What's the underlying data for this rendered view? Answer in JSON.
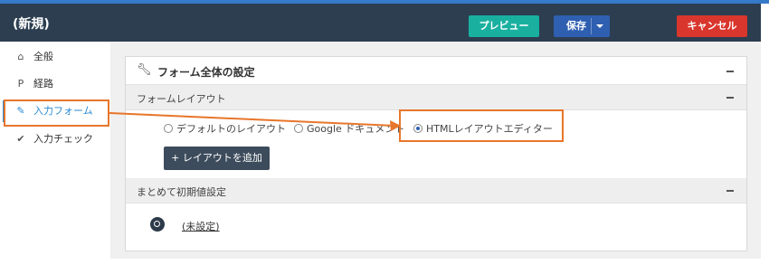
{
  "header": {
    "title": "(新規)",
    "preview_label": "プレビュー",
    "save_label": "保存",
    "cancel_label": "キャンセル"
  },
  "sidebar": {
    "items": [
      {
        "label": "全般",
        "icon": "home-icon"
      },
      {
        "label": "経路",
        "icon": "route-icon"
      },
      {
        "label": "入力フォーム",
        "icon": "pencil-icon",
        "active": true
      },
      {
        "label": "入力チェック",
        "icon": "check-icon"
      }
    ]
  },
  "panel": {
    "title": "フォーム全体の設定",
    "layout_section": {
      "label": "フォームレイアウト",
      "options": [
        {
          "label": "デフォルトのレイアウト",
          "checked": false
        },
        {
          "label": "Google ドキュメント",
          "checked": false
        },
        {
          "label": "HTMLレイアウトエディター",
          "checked": true
        }
      ],
      "add_button_label": "+ レイアウトを追加"
    },
    "initial_section": {
      "label": "まとめて初期値設定",
      "value": "(未設定)"
    }
  },
  "colors": {
    "header_bg": "#2c3e50",
    "preview": "#19b0a0",
    "save": "#2e5fb1",
    "cancel": "#d9362d",
    "annotation": "#e8762b",
    "active_nav": "#2a8ad4"
  }
}
